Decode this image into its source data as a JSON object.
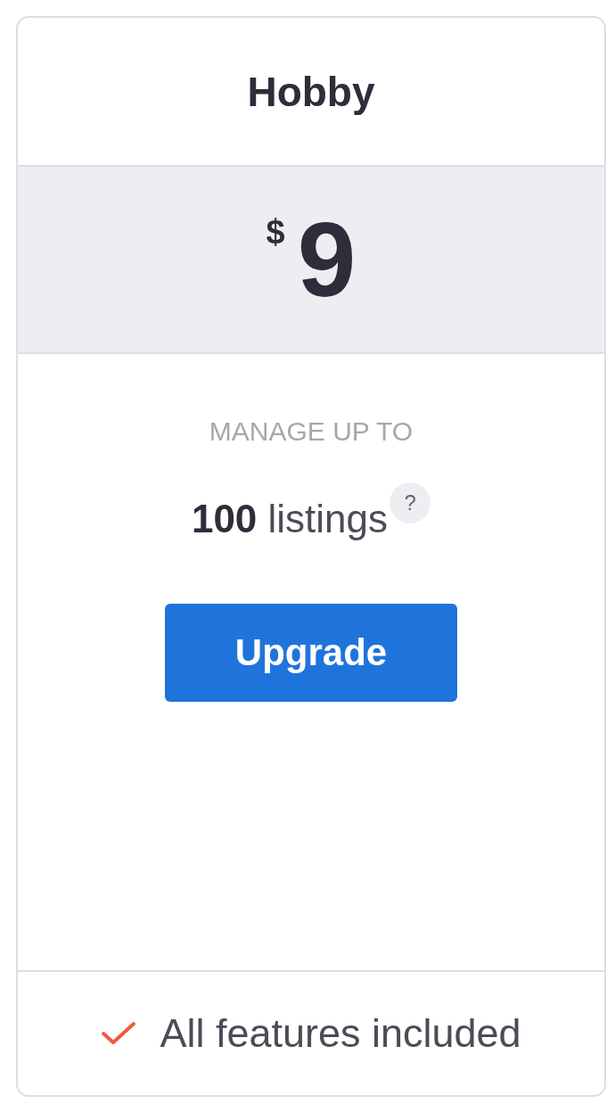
{
  "plan": {
    "title": "Hobby",
    "currency": "$",
    "price": "9",
    "limit_label": "MANAGE UP TO",
    "limit_text": "**100** listings",
    "help": "?",
    "button": "Upgrade",
    "features": [
      "All features included"
    ]
  }
}
